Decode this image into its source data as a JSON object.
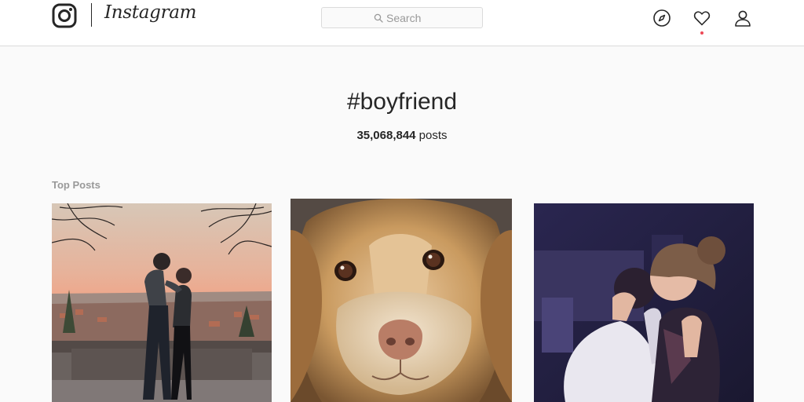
{
  "header": {
    "logo_text": "Instagram",
    "search": {
      "placeholder": "Search"
    },
    "icons": [
      "camera-logo-icon",
      "compass-icon",
      "heart-icon",
      "person-icon"
    ],
    "has_activity_notification": true,
    "colors": {
      "notification_dot": "#ed4956",
      "border": "#dbdbdb"
    }
  },
  "hashtag": {
    "title": "#boyfriend",
    "post_count": "35,068,844",
    "post_count_label": " posts"
  },
  "sections": {
    "top_posts_label": "Top Posts"
  }
}
